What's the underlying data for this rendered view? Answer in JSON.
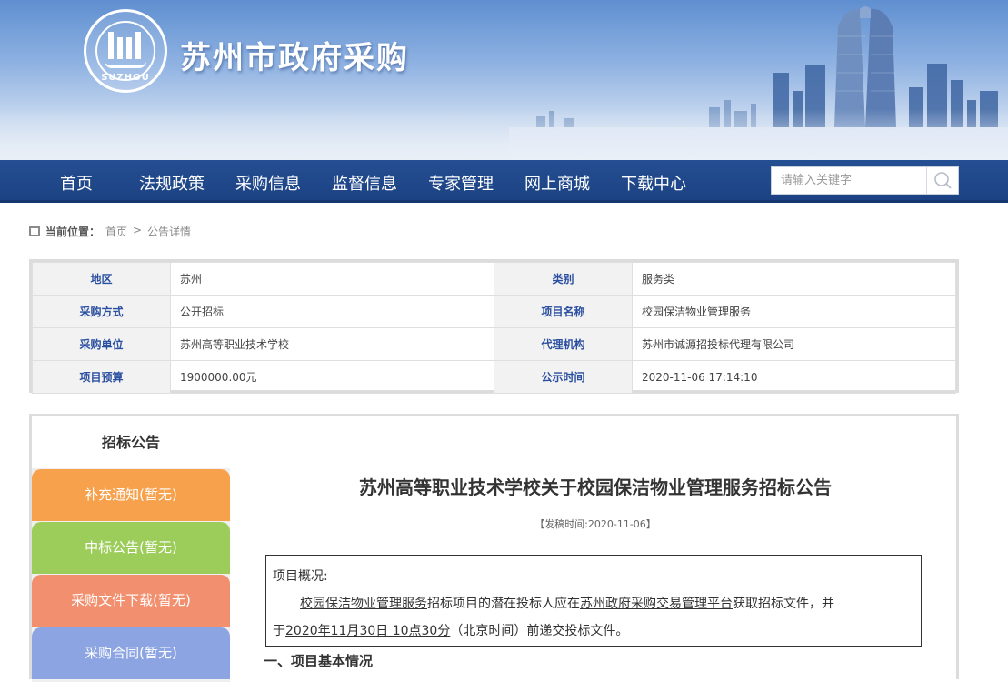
{
  "site": {
    "title": "苏州市政府采购",
    "logo_text": "SUZHOU"
  },
  "nav": {
    "items": [
      "首页",
      "法规政策",
      "采购信息",
      "监督信息",
      "专家管理",
      "网上商城",
      "下载中心"
    ],
    "search_placeholder": "请输入关键字"
  },
  "breadcrumb": {
    "label": "当前位置：",
    "home": "首页",
    "separator": ">",
    "current": "公告详情"
  },
  "info": {
    "rows": [
      [
        {
          "k": "地区",
          "v": "苏州"
        },
        {
          "k": "类别",
          "v": "服务类"
        }
      ],
      [
        {
          "k": "采购方式",
          "v": "公开招标"
        },
        {
          "k": "项目名称",
          "v": "校园保洁物业管理服务"
        }
      ],
      [
        {
          "k": "采购单位",
          "v": "苏州高等职业技术学校"
        },
        {
          "k": "代理机构",
          "v": "苏州市诚源招投标代理有限公司"
        }
      ],
      [
        {
          "k": "项目预算",
          "v": "1900000.00元"
        },
        {
          "k": "公示时间",
          "v": "2020-11-06 17:14:10"
        }
      ]
    ]
  },
  "sidebar": {
    "tabs": [
      {
        "label": "招标公告"
      },
      {
        "label": "补充通知(暂无)"
      },
      {
        "label": "中标公告(暂无)"
      },
      {
        "label": "采购文件下载(暂无)"
      },
      {
        "label": "采购合同(暂无)"
      }
    ]
  },
  "notice": {
    "title": "苏州高等职业技术学校关于校园保洁物业管理服务招标公告",
    "date": "【发稿时间:2020-11-06】",
    "overview_label": "项目概况:",
    "line1_project": "校园保洁物业管理服务",
    "line1_mid": "招标项目的潜在投标人应在",
    "line1_platform": "苏州政府采购交易管理平台",
    "line1_end": "获取招标文件，并",
    "line2_start": "于",
    "line2_time": "2020年11月30日  10点30分",
    "line2_end": "（北京时间）前递交投标文件。",
    "section1": "一、项目基本情况"
  },
  "colors": {
    "nav_bg": "#1c4283",
    "tab_orange": "#f7a14c",
    "tab_green": "#9ccd5b",
    "tab_salmon": "#f28f6e",
    "tab_blue": "#8ca4e2",
    "key_text": "#2a4fa0"
  }
}
